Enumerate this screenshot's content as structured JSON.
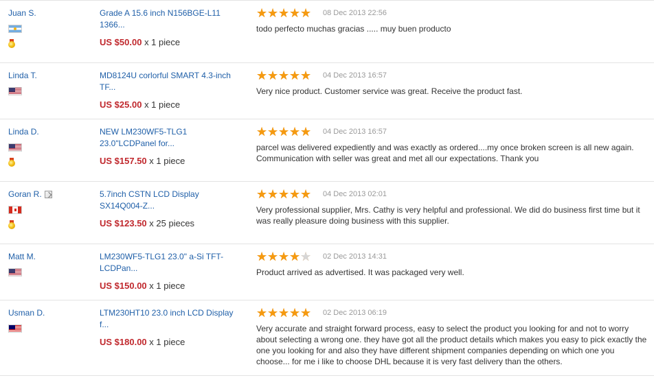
{
  "reviews": [
    {
      "name": "Juan S.",
      "verified": false,
      "flag": "flag-ar",
      "country_icon": "argentina-flag-icon",
      "medal": true,
      "product": "Grade A 15.6 inch N156BGE-L11 1366...",
      "price": "US $50.00",
      "qty": "x 1 piece",
      "stars": 5,
      "date": "08 Dec 2013 22:56",
      "text": "todo perfecto muchas gracias ..... muy buen producto"
    },
    {
      "name": "Linda T.",
      "verified": false,
      "flag": "flag-us",
      "country_icon": "usa-flag-icon",
      "medal": false,
      "product": "MD8124U corlorful SMART 4.3-inch TF...",
      "price": "US $25.00",
      "qty": "x 1 piece",
      "stars": 5,
      "date": "04 Dec 2013 16:57",
      "text": "Very nice product. Customer service was great. Receive the product fast."
    },
    {
      "name": "Linda D.",
      "verified": false,
      "flag": "flag-us",
      "country_icon": "usa-flag-icon",
      "medal": true,
      "product": "NEW LM230WF5-TLG1 23.0\"LCDPanel for...",
      "price": "US $157.50",
      "qty": "x 1 piece",
      "stars": 5,
      "date": "04 Dec 2013 16:57",
      "text": "parcel was delivered expediently and was exactly as ordered....my once broken screen is all new again. Communication with seller was great and met all our expectations. Thank you"
    },
    {
      "name": "Goran R.",
      "verified": true,
      "flag": "flag-ca",
      "country_icon": "canada-flag-icon",
      "medal": true,
      "product": "5.7inch CSTN LCD Display SX14Q004-Z...",
      "price": "US $123.50",
      "qty": "x 25 pieces",
      "stars": 5,
      "date": "04 Dec 2013 02:01",
      "text": "Very professional supplier, Mrs. Cathy is very helpful and professional. We did do business first time but it was really pleasure doing business with this supplier."
    },
    {
      "name": "Matt M.",
      "verified": false,
      "flag": "flag-us",
      "country_icon": "usa-flag-icon",
      "medal": false,
      "product": "LM230WF5-TLG1 23.0\" a-Si TFT-LCDPan...",
      "price": "US $150.00",
      "qty": "x 1 piece",
      "stars": 4,
      "date": "02 Dec 2013 14:31",
      "text": "Product arrived as advertised. It was packaged very well."
    },
    {
      "name": "Usman D.",
      "verified": false,
      "flag": "flag-my",
      "country_icon": "malaysia-flag-icon",
      "medal": false,
      "product": "LTM230HT10 23.0 inch LCD Display f...",
      "price": "US $180.00",
      "qty": "x 1 piece",
      "stars": 5,
      "date": "02 Dec 2013 06:19",
      "text": "Very accurate and straight forward process, easy to select the product you looking for and not to worry about selecting a wrong one. they have got all the product details which makes you easy to pick exactly the one you looking for and also they have different shipment companies depending on which one you choose... for me i like to choose DHL because it is very fast delivery than the others."
    }
  ],
  "colors": {
    "link": "#1f5fa8",
    "price": "#c0282d",
    "star": "#f59a11",
    "star_off": "#d6d6d6",
    "date": "#999999"
  }
}
